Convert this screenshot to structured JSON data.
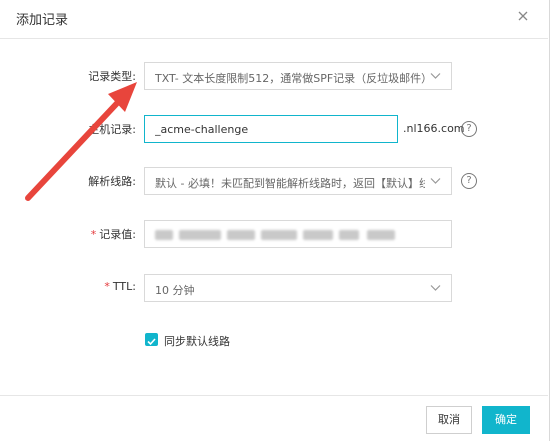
{
  "dialog": {
    "title": "添加记录"
  },
  "form": {
    "record_type": {
      "label": "记录类型:",
      "value": "TXT- 文本长度限制512，通常做SPF记录（反垃圾邮件）"
    },
    "host_record": {
      "label": "主机记录:",
      "value": "_acme-challenge",
      "suffix": ".nl166.com"
    },
    "resolve_line": {
      "label": "解析线路:",
      "value": "默认 - 必填！未匹配到智能解析线路时，返回【默认】线路..."
    },
    "record_value": {
      "label": "记录值:",
      "required_mark": "*"
    },
    "ttl": {
      "label": "TTL:",
      "required_mark": "*",
      "value": "10 分钟"
    },
    "sync_default": {
      "label": "同步默认线路",
      "checked": true
    }
  },
  "footer": {
    "cancel_label": "取消",
    "ok_label": "确定"
  },
  "colors": {
    "accent": "#11b5cc",
    "arrow": "#e8453c",
    "required": "#e4393c"
  },
  "icons": {
    "close": "close-icon",
    "chevron": "chevron-down-icon",
    "help": "help-icon",
    "check": "check-icon"
  }
}
